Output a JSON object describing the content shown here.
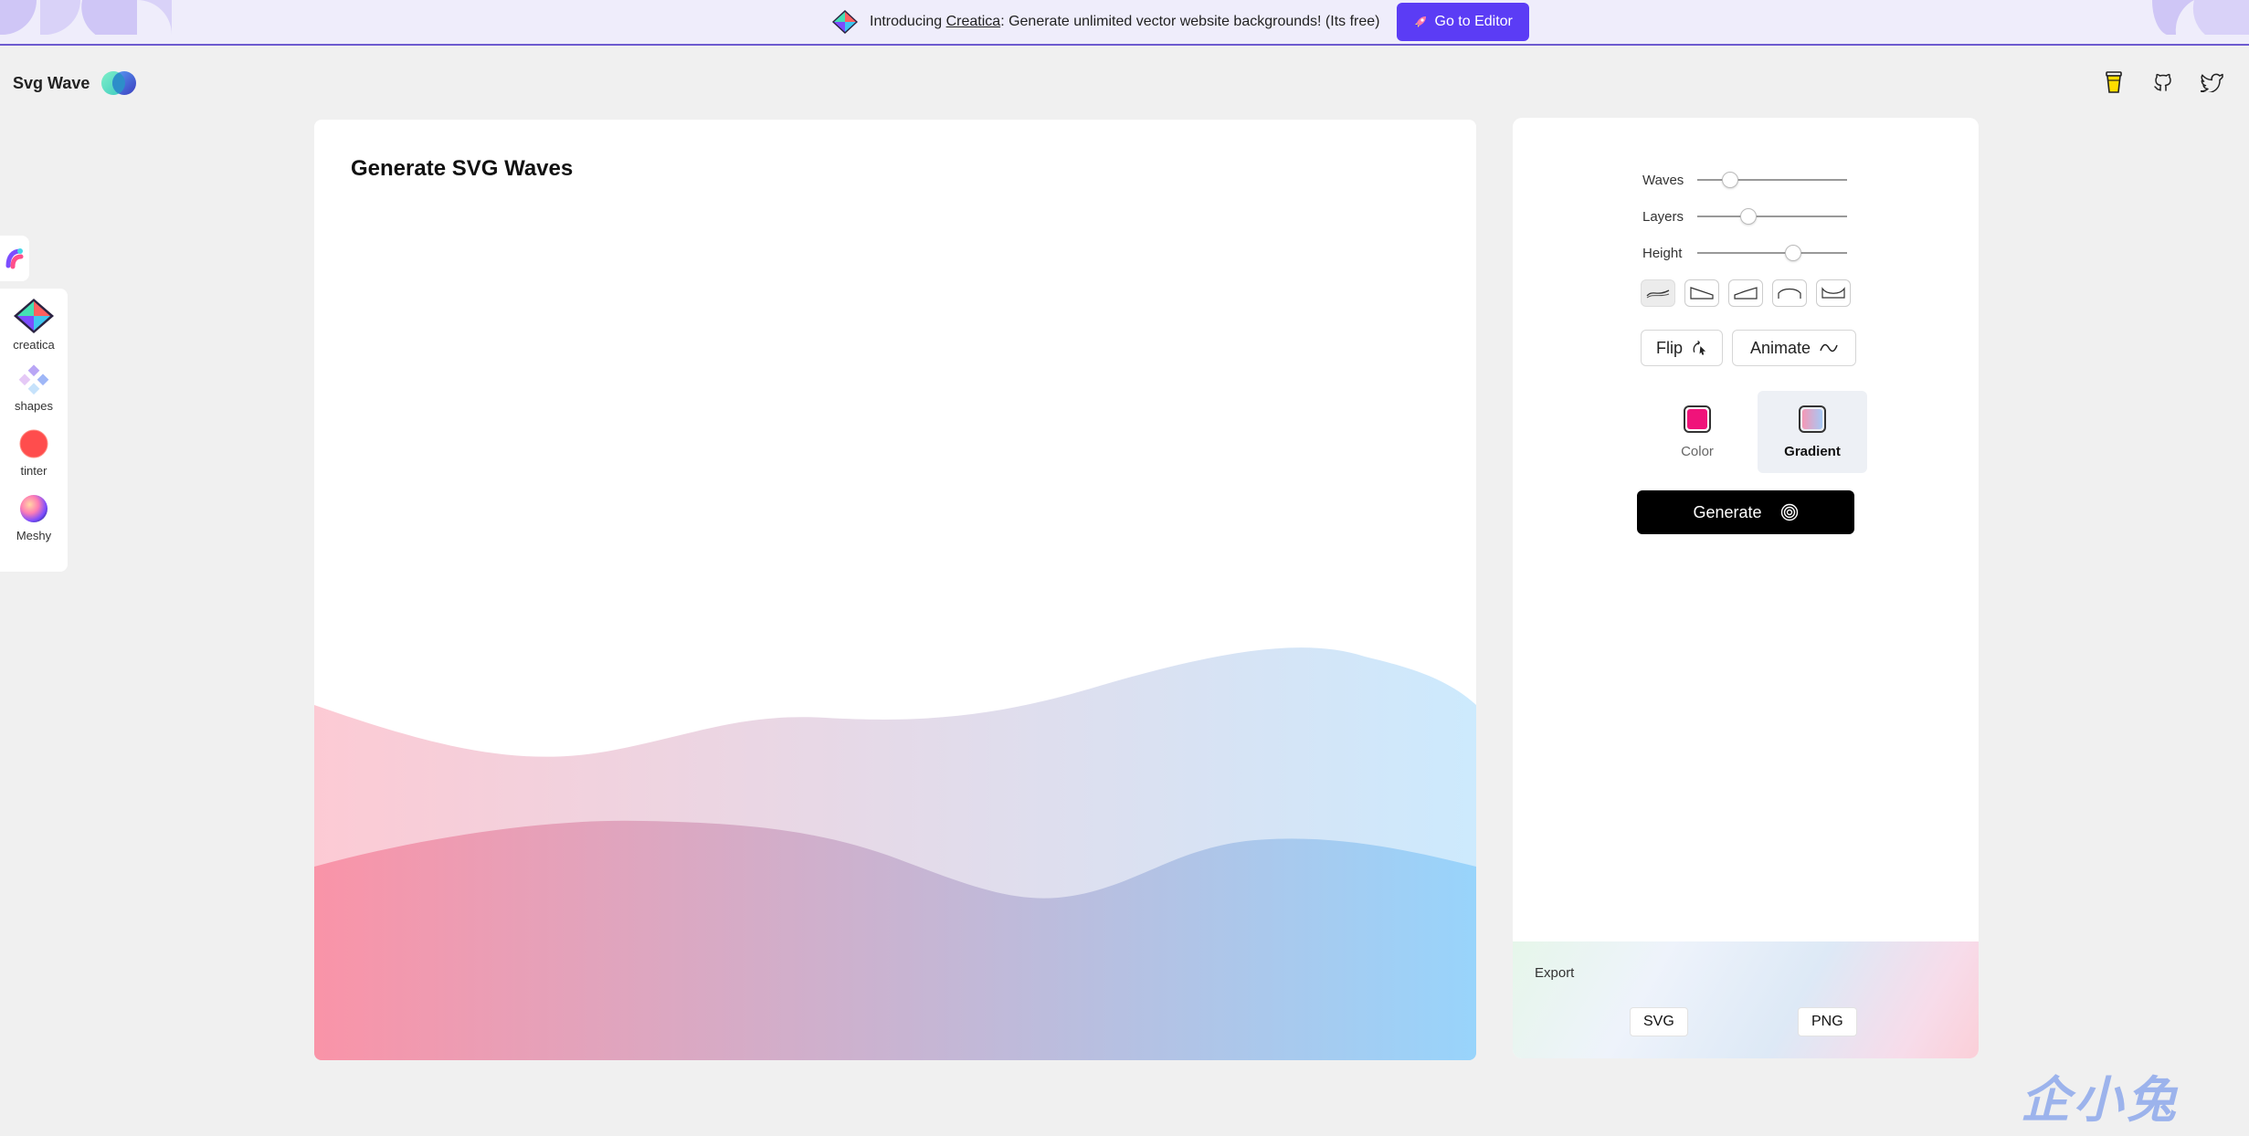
{
  "banner": {
    "text_prefix": "Introducing ",
    "link_text": "Creatica",
    "text_suffix": ": Generate unlimited vector website backgrounds! (Its free)",
    "cta_label": "Go to Editor",
    "cta_icon": "rocket-icon"
  },
  "header": {
    "app_name": "Svg Wave",
    "icons": [
      "coffee-cup-icon",
      "github-icon",
      "twitter-icon"
    ]
  },
  "sidebar": {
    "tab_icon": "svgwave-app-icon",
    "apps": [
      {
        "label": "creatica",
        "icon": "creatica-icon"
      },
      {
        "label": "shapes",
        "icon": "shapes-icon"
      },
      {
        "label": "tinter",
        "icon": "tinter-icon"
      },
      {
        "label": "Meshy",
        "icon": "meshy-icon"
      }
    ]
  },
  "preview": {
    "title": "Generate SVG Waves",
    "gradient": {
      "start": "#f98aa0",
      "end": "#8fd0fb"
    }
  },
  "controls": {
    "sliders": [
      {
        "label": "Waves",
        "value": 0.22
      },
      {
        "label": "Layers",
        "value": 0.34
      },
      {
        "label": "Height",
        "value": 0.64
      }
    ],
    "shapes": [
      "smooth-wave-icon",
      "step-wave-icon",
      "peak-wave-icon",
      "arch-wave-icon",
      "bowl-wave-icon"
    ],
    "flip_label": "Flip",
    "animate_label": "Animate",
    "fill_options": [
      {
        "label": "Color",
        "swatch": "#f0137a"
      },
      {
        "label": "Gradient",
        "swatch_from": "#f598b6",
        "swatch_to": "#a6c9f5"
      }
    ],
    "generate_label": "Generate",
    "export": {
      "label": "Export",
      "svg": "SVG",
      "png": "PNG"
    }
  },
  "watermark": "企小兔"
}
